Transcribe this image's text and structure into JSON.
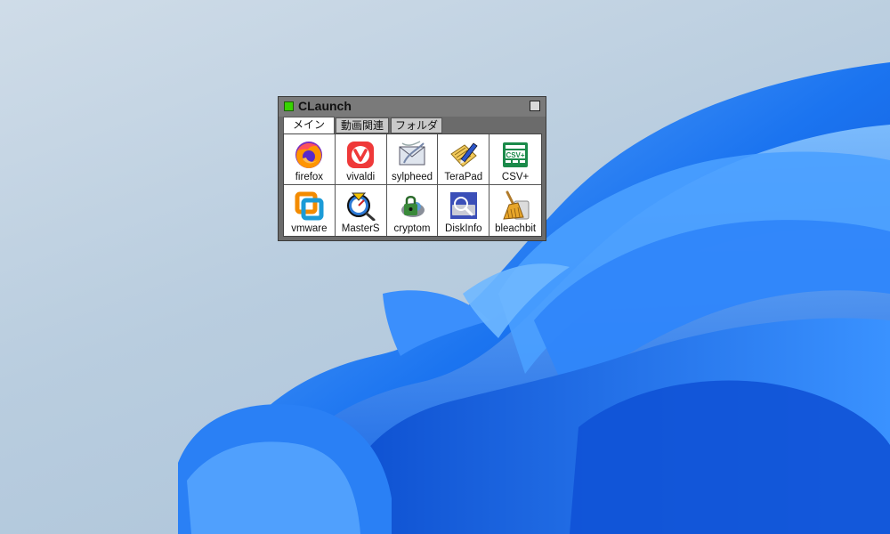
{
  "window": {
    "title": "CLaunch"
  },
  "tabs": [
    {
      "label": "メイン",
      "active": true
    },
    {
      "label": "動画関連",
      "active": false
    },
    {
      "label": "フォルダ",
      "active": false
    }
  ],
  "apps": [
    {
      "label": "firefox",
      "icon": "firefox-icon"
    },
    {
      "label": "vivaldi",
      "icon": "vivaldi-icon"
    },
    {
      "label": "sylpheed",
      "icon": "sylpheed-icon"
    },
    {
      "label": "TeraPad",
      "icon": "terapad-icon"
    },
    {
      "label": "CSV+",
      "icon": "csv-plus-icon",
      "icon_text": "CSV+"
    },
    {
      "label": "vmware",
      "icon": "vmware-icon"
    },
    {
      "label": "MasterS",
      "icon": "masters-icon"
    },
    {
      "label": "cryptom",
      "icon": "cryptomator-icon"
    },
    {
      "label": "DiskInfo",
      "icon": "diskinfo-icon"
    },
    {
      "label": "bleachbit",
      "icon": "bleachbit-icon"
    }
  ],
  "colors": {
    "wallpaper_blue": "#1a73e8",
    "launcher_frame": "#6b6b6b",
    "title_indicator": "#37d400"
  }
}
